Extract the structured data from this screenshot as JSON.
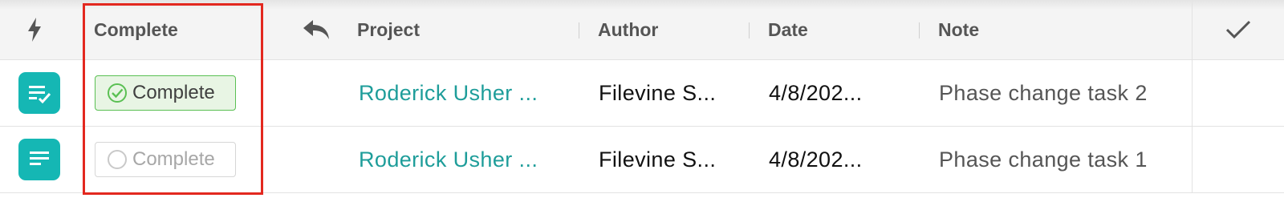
{
  "header": {
    "complete": "Complete",
    "project": "Project",
    "author": "Author",
    "date": "Date",
    "note": "Note"
  },
  "icons": {
    "header_action": "lightning-bolt-icon",
    "reply": "reply-arrow-icon",
    "select_all": "checkmark-icon",
    "row_done": "task-list-check-icon",
    "row_open": "task-list-icon"
  },
  "colors": {
    "accent": "#15b7b4",
    "link": "#1e9d9a",
    "complete_green": "#5ac053",
    "highlight_red": "#e3281f"
  },
  "rows": [
    {
      "status_label": "Complete",
      "completed": true,
      "project": "Roderick Usher ...",
      "author": "Filevine S...",
      "date": "4/8/202...",
      "note": "Phase change task 2"
    },
    {
      "status_label": "Complete",
      "completed": false,
      "project": "Roderick Usher ...",
      "author": "Filevine S...",
      "date": "4/8/202...",
      "note": "Phase change task 1"
    }
  ]
}
